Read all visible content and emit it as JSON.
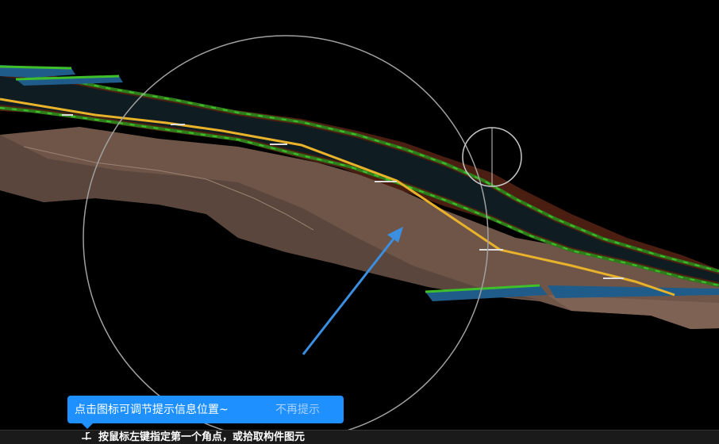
{
  "tooltip": {
    "message": "点击图标可调节提示信息位置~",
    "dismiss_label": "不再提示"
  },
  "status_bar": {
    "prompt": "按鼠标左键指定第一个角点，或拾取构件图元",
    "icon": "crosshair-icon"
  },
  "colors": {
    "tooltip_bg": "#1e90ff",
    "road_surface": "#0f1c22",
    "centerline": "#e8b22a",
    "curb_green": "#2e7d1a",
    "terrain": "#6e5548",
    "arrow": "#3b8fe0"
  }
}
